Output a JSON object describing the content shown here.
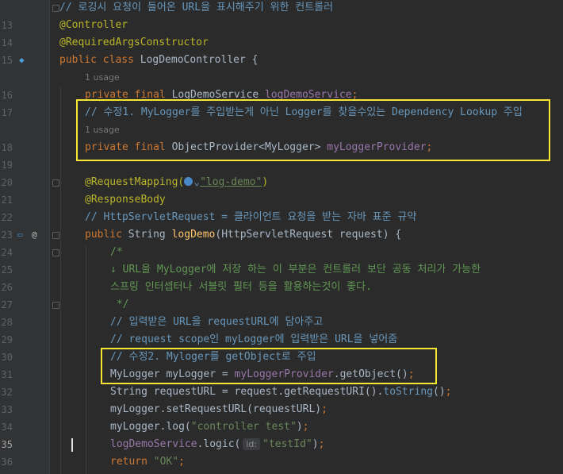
{
  "editor": {
    "lines": [
      {
        "no": "",
        "kind": "code",
        "tokens": [
          {
            "t": "// 로깅시 요청이 들어온 URL을 표시해주기 위한 컨트롤러",
            "c": "cmt"
          }
        ]
      },
      {
        "no": "13",
        "kind": "code",
        "tokens": [
          {
            "t": "@Controller",
            "c": "ann"
          }
        ]
      },
      {
        "no": "14",
        "kind": "code",
        "tokens": [
          {
            "t": "@RequiredArgsConstructor",
            "c": "ann"
          }
        ]
      },
      {
        "no": "15",
        "kind": "code",
        "tokens": [
          {
            "t": "public class ",
            "c": "kw"
          },
          {
            "t": "LogDemoController ",
            "c": "plain"
          },
          {
            "t": "{",
            "c": "plain"
          }
        ]
      },
      {
        "no": "",
        "kind": "hint",
        "text": "1 usage"
      },
      {
        "no": "16",
        "kind": "code",
        "tokens": [
          {
            "t": "private final ",
            "c": "kw"
          },
          {
            "t": "LogDemoService ",
            "c": "plain"
          },
          {
            "t": "logDemoService",
            "c": "fld"
          },
          {
            "t": ";",
            "c": "kw"
          }
        ]
      },
      {
        "no": "17",
        "kind": "code",
        "tokens": [
          {
            "t": "// 수정1. MyLogger를 주입받는게 아닌 Logger를 찾을수있는 Dependency Lookup 주입",
            "c": "cmt"
          }
        ]
      },
      {
        "no": "",
        "kind": "hint",
        "text": "1 usage"
      },
      {
        "no": "18",
        "kind": "code",
        "tokens": [
          {
            "t": "private final ",
            "c": "kw"
          },
          {
            "t": "ObjectProvider<MyLogger> ",
            "c": "plain"
          },
          {
            "t": "myLoggerProvider",
            "c": "fld"
          },
          {
            "t": ";",
            "c": "kw"
          }
        ]
      },
      {
        "no": "19",
        "kind": "code",
        "tokens": []
      },
      {
        "no": "20",
        "kind": "code",
        "tokens": [
          {
            "t": "@RequestMapping(",
            "c": "ann"
          },
          {
            "t": "GLOBE",
            "c": "globe"
          },
          {
            "t": "\"log-demo\"",
            "c": "str"
          },
          {
            "t": ")",
            "c": "ann"
          }
        ]
      },
      {
        "no": "21",
        "kind": "code",
        "tokens": [
          {
            "t": "@ResponseBody",
            "c": "ann"
          }
        ]
      },
      {
        "no": "22",
        "kind": "code",
        "tokens": [
          {
            "t": "// HttpServletRequest = 클라이언트 요청을 받는 자바 표준 규약",
            "c": "cmt"
          }
        ]
      },
      {
        "no": "23",
        "kind": "code",
        "tokens": [
          {
            "t": "public ",
            "c": "kw"
          },
          {
            "t": "String ",
            "c": "plain"
          },
          {
            "t": "logDemo",
            "c": "fn"
          },
          {
            "t": "(HttpServletRequest request) {",
            "c": "plain"
          }
        ]
      },
      {
        "no": "24",
        "kind": "code",
        "tokens": [
          {
            "t": "/*",
            "c": "doc"
          }
        ]
      },
      {
        "no": "25",
        "kind": "code",
        "tokens": [
          {
            "t": "↓ URL을 MyLogger에 저장 하는 이 부분은 컨트롤러 보단 공동 처리가 가능한",
            "c": "doc"
          }
        ]
      },
      {
        "no": "26",
        "kind": "code",
        "tokens": [
          {
            "t": "스프링 인터셉터나 서블릿 필터 등을 활용하는것이 좋다.",
            "c": "doc"
          }
        ]
      },
      {
        "no": "27",
        "kind": "code",
        "tokens": [
          {
            "t": " */",
            "c": "doc"
          }
        ]
      },
      {
        "no": "28",
        "kind": "code",
        "tokens": [
          {
            "t": "// 입력받은 URL을 requestURL에 담아주고",
            "c": "cmt"
          }
        ]
      },
      {
        "no": "29",
        "kind": "code",
        "tokens": [
          {
            "t": "// request scope인 myLogger에 입력받은 URL을 넣어줌",
            "c": "cmt"
          }
        ]
      },
      {
        "no": "30",
        "kind": "code",
        "tokens": [
          {
            "t": "// 수정2. Myloger를 getObject로 주입",
            "c": "cmt"
          }
        ]
      },
      {
        "no": "31",
        "kind": "code",
        "tokens": [
          {
            "t": "MyLogger myLogger = ",
            "c": "plain"
          },
          {
            "t": "myLoggerProvider",
            "c": "fld"
          },
          {
            "t": ".getObject()",
            "c": "plain"
          },
          {
            "t": ";",
            "c": "kw"
          }
        ]
      },
      {
        "no": "32",
        "kind": "code",
        "tokens": [
          {
            "t": "String requestURL = request.getRequestURI().",
            "c": "plain"
          },
          {
            "t": "toString",
            "c": "cmt"
          },
          {
            "t": "()",
            "c": "plain"
          },
          {
            "t": ";",
            "c": "kw"
          }
        ]
      },
      {
        "no": "33",
        "kind": "code",
        "tokens": [
          {
            "t": "myLogger.setRequestURL(requestURL)",
            "c": "plain"
          },
          {
            "t": ";",
            "c": "kw"
          }
        ]
      },
      {
        "no": "34",
        "kind": "code",
        "tokens": [
          {
            "t": "myLogger.log(",
            "c": "plain"
          },
          {
            "t": "\"controller test\"",
            "c": "str"
          },
          {
            "t": ")",
            "c": "plain"
          },
          {
            "t": ";",
            "c": "kw"
          }
        ]
      },
      {
        "no": "35",
        "kind": "code",
        "active": true,
        "tokens": [
          {
            "t": "logDemoService",
            "c": "fld"
          },
          {
            "t": ".logic(",
            "c": "plain"
          },
          {
            "t": "id:",
            "c": "hint"
          },
          {
            "t": "\"testId\"",
            "c": "str"
          },
          {
            "t": ")",
            "c": "plain"
          },
          {
            "t": ";",
            "c": "kw"
          }
        ]
      },
      {
        "no": "36",
        "kind": "code",
        "tokens": [
          {
            "t": "return ",
            "c": "kw"
          },
          {
            "t": "\"OK\"",
            "c": "str"
          },
          {
            "t": ";",
            "c": "kw"
          }
        ]
      }
    ]
  },
  "colors": {
    "highlight": "#f5e634",
    "keyword": "#cc7832",
    "annotation": "#bbb529",
    "field": "#9876aa",
    "method": "#ffc66d",
    "string": "#6a8759"
  }
}
